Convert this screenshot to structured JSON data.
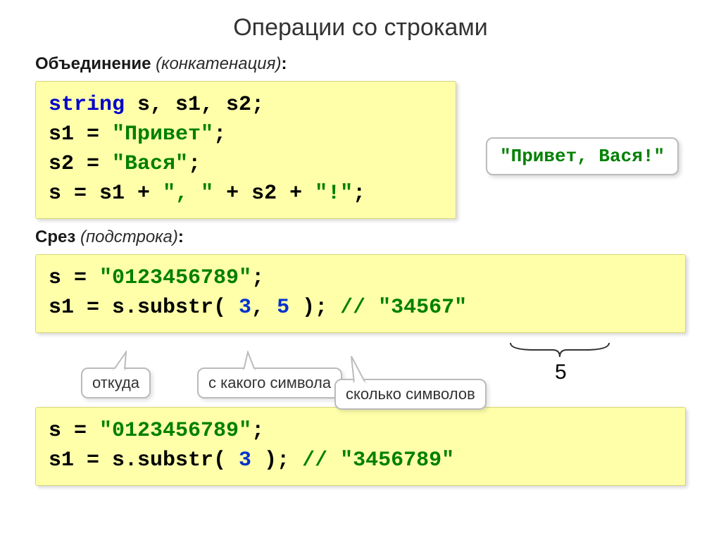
{
  "title": "Операции со строками",
  "section1": {
    "bold": "Объединение",
    "italic": "(конкатенация)",
    "colon": ":"
  },
  "code1": {
    "l1_kw": "string",
    "l1_rest": " s, s1, s2;",
    "l2a": "s1",
    "l2eq": " = ",
    "l2s": "\"Привет\"",
    "l2semi": ";",
    "l3a": "s2",
    "l3eq": " = ",
    "l3s": "\"Вася\"",
    "l3semi": ";",
    "l4a": "s",
    "l4eq": " = ",
    "l4b": "s1",
    "l4p1": " + ",
    "l4s1": "\",  \"",
    "l4p2": " + ",
    "l4c": "s2",
    "l4p3": " + ",
    "l4s2": "\"!\"",
    "l4semi": ";"
  },
  "callout1": "\"Привет, Вася!\"",
  "section2": {
    "bold": "Срез",
    "italic": "(подстрока)",
    "colon": ":"
  },
  "code2": {
    "l1a": "s",
    "l1eq": " = ",
    "l1s": "\"0123456789\"",
    "l1semi": ";",
    "l2a": "s1 = s.substr( ",
    "l2n1": "3",
    "l2c": ", ",
    "l2n2": "5",
    "l2p": " );    ",
    "l2cmt": "// \"34567\""
  },
  "annot1": "откуда",
  "annot2": "с какого символа",
  "annot3": "сколько символов",
  "five": "5",
  "code3": {
    "l1a": "s",
    "l1eq": " = ",
    "l1s": "\"0123456789\"",
    "l1semi": ";",
    "l2a": "s1 = s.substr( ",
    "l2n1": "3",
    "l2p": " );    ",
    "l2cmt": "// \"3456789\""
  }
}
